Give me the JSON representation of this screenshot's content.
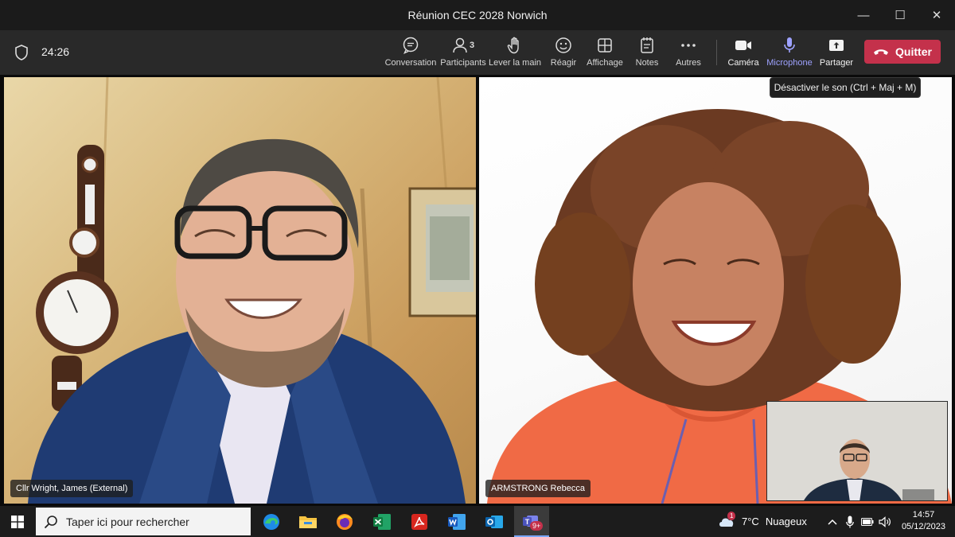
{
  "window": {
    "title": "Réunion CEC 2028 Norwich",
    "minimize_glyph": "—",
    "maximize_glyph": "☐",
    "close_glyph": "✕"
  },
  "toolbar": {
    "timer": "24:26",
    "buttons": [
      {
        "label": "Conversation",
        "icon": "chat-icon"
      },
      {
        "label": "Participants",
        "icon": "people-icon",
        "count": "3"
      },
      {
        "label": "Lever la main",
        "icon": "hand-icon"
      },
      {
        "label": "Réagir",
        "icon": "smiley-icon"
      },
      {
        "label": "Affichage",
        "icon": "grid-icon"
      },
      {
        "label": "Notes",
        "icon": "notes-icon"
      },
      {
        "label": "Autres",
        "icon": "more-icon"
      },
      {
        "label": "Caméra",
        "icon": "camera-icon"
      },
      {
        "label": "Microphone",
        "icon": "microphone-icon",
        "active": true
      },
      {
        "label": "Partager",
        "icon": "share-icon"
      }
    ],
    "quit_label": "Quitter",
    "accent": "#9ea2ff",
    "quit_color": "#c4314b"
  },
  "tooltip": {
    "text": "Désactiver le son (Ctrl + Maj + M)"
  },
  "participants": [
    {
      "name": "Cllr Wright, James (External)"
    },
    {
      "name": "ARMSTRONG Rebecca"
    }
  ],
  "taskbar": {
    "search_placeholder": "Taper ici pour rechercher",
    "apps": [
      "edge-icon",
      "file-explorer-icon",
      "firefox-icon",
      "excel-icon",
      "acrobat-icon",
      "word-icon",
      "outlook-icon",
      "teams-icon"
    ],
    "teams_badge": "9+",
    "weather_badge": "1",
    "weather_temp": "7°C",
    "weather_text": "Nuageux",
    "time": "14:57",
    "date": "05/12/2023"
  }
}
